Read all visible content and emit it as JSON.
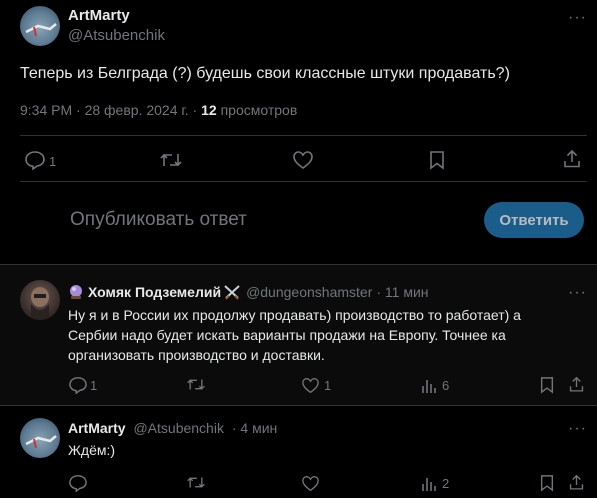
{
  "main_tweet": {
    "display_name": "ArtMarty",
    "handle": "@Atsubenchik",
    "text": "Теперь из Белграда (?) будешь свои классные штуки продавать?)",
    "time": "9:34 PM · 28 февр. 2024 г. · ",
    "views_count": "12",
    "views_label": " просмотров",
    "replies": "1"
  },
  "composer": {
    "placeholder": "Опубликовать ответ",
    "reply_button": "Ответить"
  },
  "replies": [
    {
      "display_name": "Хомяк Подземелий",
      "handle": "@dungeonshamster",
      "time": "· 11 мин",
      "text": "Ну я и в России их продолжу продавать) производство то работает) а Сербии надо будет искать варианты продажи на Европу. Точнее ка организовать производство и доставки.",
      "replies": "1",
      "likes": "1",
      "views": "6"
    },
    {
      "display_name": "ArtMarty",
      "handle": "@Atsubenchik",
      "time": "· 4 мин",
      "text": "Ждём:)",
      "views": "2"
    }
  ],
  "colors": {
    "accent": "#1d9bf0",
    "reply_button_bg": "#1a5c8a",
    "muted": "#71767b",
    "border": "#2f3336"
  }
}
